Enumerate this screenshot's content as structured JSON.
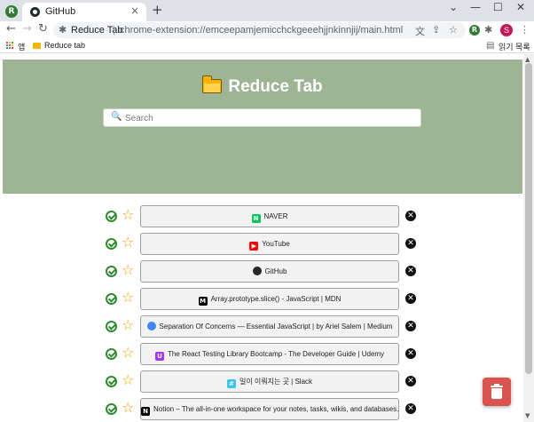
{
  "browser": {
    "tab_title": "GitHub",
    "tab_close": "×",
    "new_tab": "+",
    "ext_badge": "R",
    "address_name": "Reduce Tab",
    "address_url": "chrome-extension://emceepamjemicchckgeeehjjnkinnjij/main.html",
    "avatar_initial": "S",
    "window_min": "—",
    "window_max": "☐",
    "window_close": "✕",
    "window_collapse": "⌄"
  },
  "bookmarks": {
    "apps_label": "앱",
    "items": [
      {
        "label": "Reduce tab"
      }
    ],
    "reading_list": "읽기 목록"
  },
  "page": {
    "title": "Reduce Tab",
    "search_placeholder": "Search"
  },
  "links": [
    {
      "title": "NAVER",
      "favicon": "naver-icon",
      "favicon_text": "N",
      "favicon_color": "#03c75a"
    },
    {
      "title": "YouTube",
      "favicon": "youtube-icon",
      "favicon_text": "▶",
      "favicon_color": "#ff0000"
    },
    {
      "title": "GitHub",
      "favicon": "github-icon",
      "favicon_text": "",
      "favicon_color": "#24292f"
    },
    {
      "title": "Array.prototype.slice() - JavaScript | MDN",
      "favicon": "mdn-icon",
      "favicon_text": "M",
      "favicon_color": "#000000"
    },
    {
      "title": "Separation Of Concerns — Essential JavaScript | by Ariel Salem | Medium",
      "favicon": "chrome-icon",
      "favicon_text": "",
      "favicon_color": "#4285f4"
    },
    {
      "title": "The React Testing Library Bootcamp - The Developer Guide | Udemy",
      "favicon": "udemy-icon",
      "favicon_text": "U",
      "favicon_color": "#a435f0"
    },
    {
      "title": "일이 이뤄지는 곳 | Slack",
      "favicon": "slack-icon",
      "favicon_text": "#",
      "favicon_color": "#36c5f0"
    },
    {
      "title": "Notion – The all-in-one workspace for your notes, tasks, wikis, and databases.",
      "favicon": "notion-icon",
      "favicon_text": "N",
      "favicon_color": "#000000"
    }
  ],
  "colors": {
    "hero": "#9db594",
    "check": "#2e8b2e",
    "star": "#e8a400",
    "trash": "#d9534f"
  }
}
